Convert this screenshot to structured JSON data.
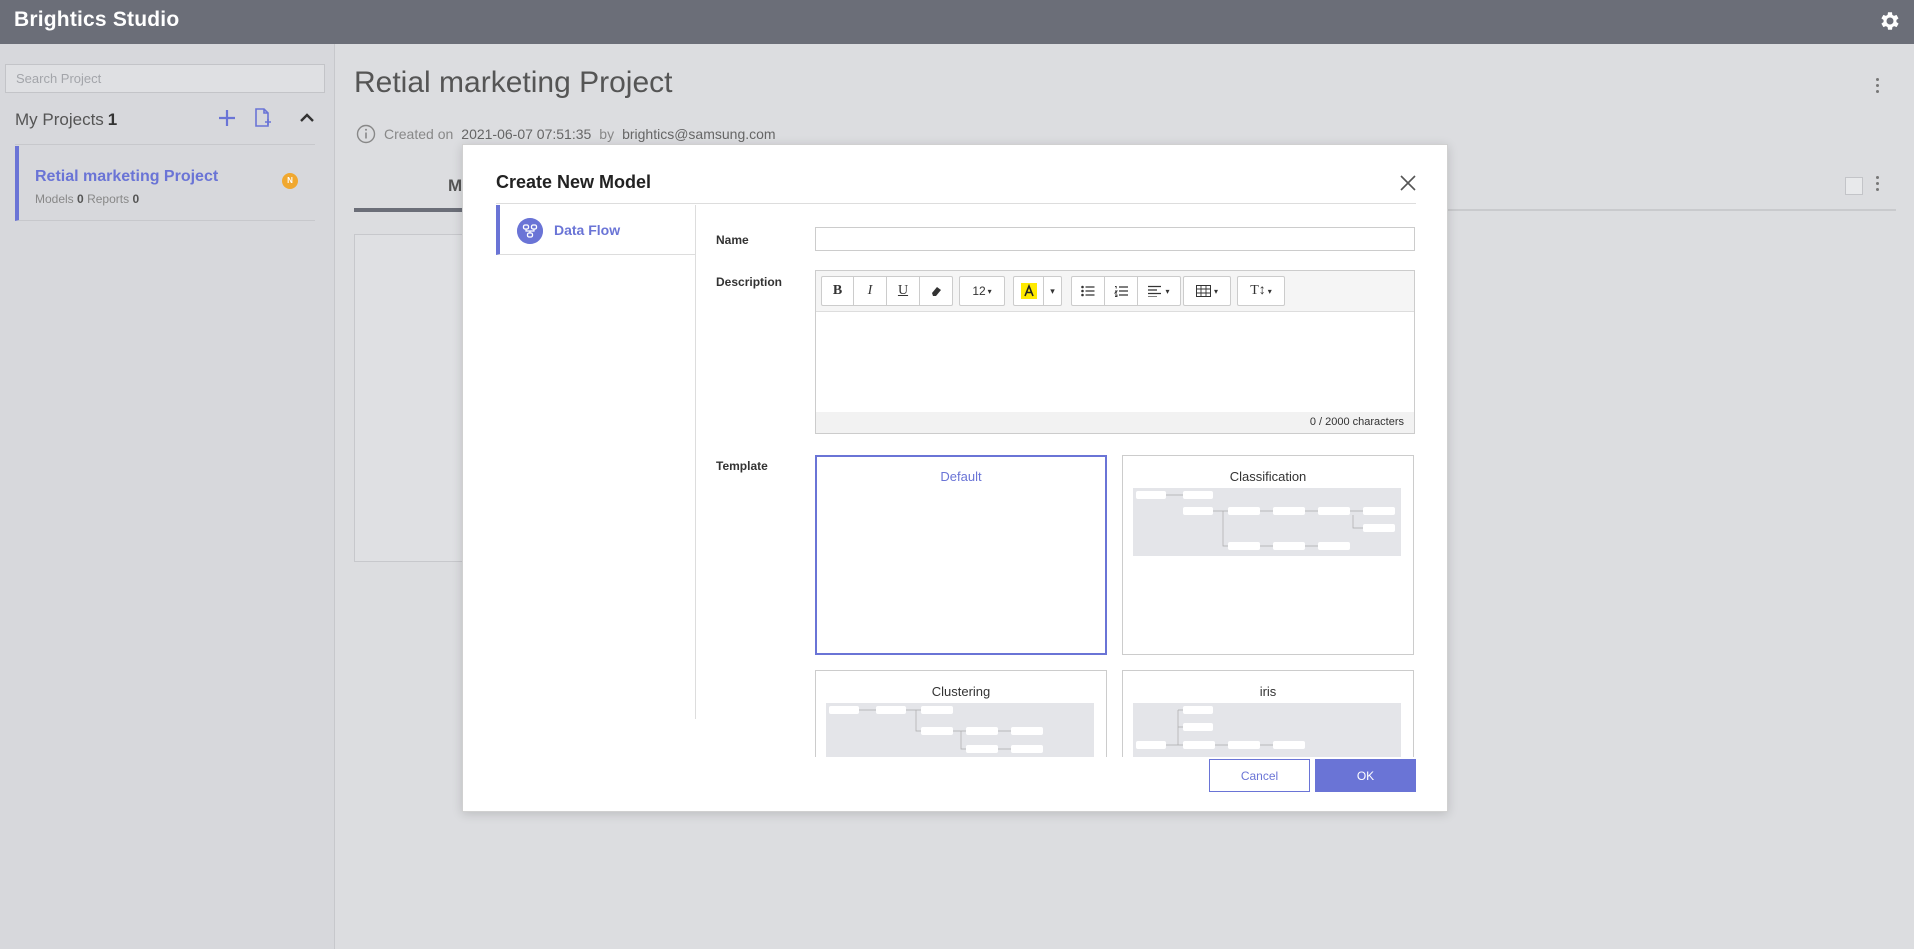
{
  "app": {
    "title": "Brightics Studio"
  },
  "sidebar": {
    "search_placeholder": "Search Project",
    "section_label": "My Projects",
    "project_count": "1",
    "projects": [
      {
        "name": "Retial marketing Project",
        "models_label": "Models",
        "models": "0",
        "reports_label": "Reports",
        "reports": "0",
        "badge": "N"
      }
    ]
  },
  "main": {
    "project_title": "Retial marketing Project",
    "created_label": "Created on",
    "created_at": "2021-06-07 07:51:35",
    "by_label": "by",
    "author": "brightics@samsung.com",
    "active_tab_initial": "M"
  },
  "modal": {
    "title": "Create New Model",
    "nav_items": [
      {
        "label": "Data Flow"
      }
    ],
    "name_label": "Name",
    "name_value": "",
    "description_label": "Description",
    "font_size": "12",
    "char_counter": "0 / 2000 characters",
    "template_label": "Template",
    "templates": [
      {
        "name": "Default",
        "selected": true
      },
      {
        "name": "Classification",
        "selected": false
      },
      {
        "name": "Clustering",
        "selected": false
      },
      {
        "name": "iris",
        "selected": false
      }
    ],
    "cancel_label": "Cancel",
    "ok_label": "OK"
  },
  "colors": {
    "accent": "#6a74d6",
    "topbar": "#6b6e78",
    "badge": "#f0a830"
  },
  "icons": [
    "settings-gear-icon",
    "add-project-icon",
    "import-project-icon",
    "collapse-chevron-icon",
    "info-icon",
    "more-vertical-icon",
    "close-icon",
    "data-flow-icon"
  ]
}
